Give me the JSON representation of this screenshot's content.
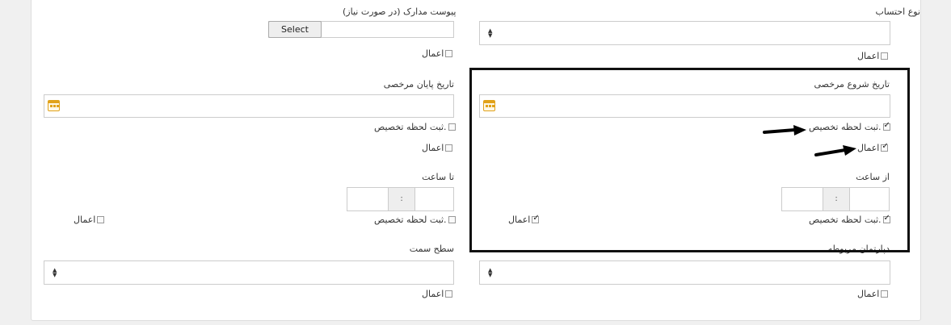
{
  "fields": {
    "leave_type_label": "نوع احتساب",
    "attachment_label": "پیوست مدارک (در صورت نیاز)",
    "attachment_button": "Select",
    "start_date_label": "تاریخ شروع مرخصی",
    "end_date_label": "تاریخ پایان مرخصی",
    "from_time_label": "از ساعت",
    "to_time_label": "تا ساعت",
    "time_separator": ":",
    "related_dept_label": "دپارتمان مربوطه",
    "access_level_label": "سطح سمت"
  },
  "checks": {
    "apply": "اعمال",
    "record_moment": "ثبت لحظه تخصیص."
  },
  "checkbox_state": {
    "leave_type_apply": false,
    "attachment_apply": false,
    "start_record": true,
    "start_apply": true,
    "end_record": false,
    "end_apply": false,
    "from_record": true,
    "from_apply": true,
    "to_record": false,
    "to_apply": false,
    "dept_apply": false,
    "access_apply": false
  },
  "icons": {
    "select_arrows": "select-updown-icon",
    "calendar": "calendar-icon",
    "annotation": "arrow-right-icon"
  },
  "colors": {
    "calendar_accent": "#e1a21a",
    "highlight_border": "#111111"
  }
}
